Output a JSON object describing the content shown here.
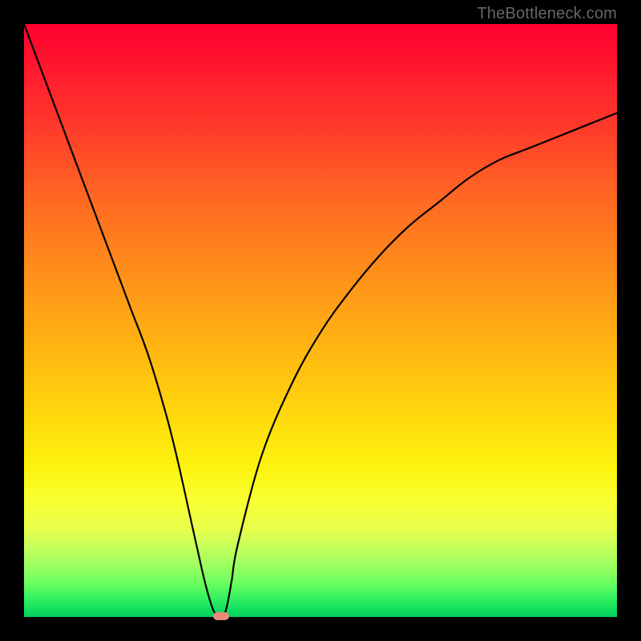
{
  "watermark": "TheBottleneck.com",
  "chart_data": {
    "type": "line",
    "title": "",
    "xlabel": "",
    "ylabel": "",
    "xlim": [
      0,
      100
    ],
    "ylim": [
      0,
      100
    ],
    "grid": false,
    "legend": false,
    "series": [
      {
        "name": "bottleneck-curve",
        "x": [
          0,
          3,
          6,
          9,
          12,
          15,
          18,
          21,
          24,
          26,
          28,
          30,
          31,
          32,
          33,
          34,
          35,
          36,
          40,
          45,
          50,
          55,
          60,
          65,
          70,
          75,
          80,
          85,
          90,
          95,
          100
        ],
        "values": [
          100,
          92,
          84,
          76,
          68,
          60,
          52,
          44,
          34,
          26,
          17,
          8,
          4,
          1,
          0,
          1,
          6,
          12,
          27,
          39,
          48,
          55,
          61,
          66,
          70,
          74,
          77,
          79,
          81,
          83,
          85
        ]
      }
    ],
    "marker": {
      "x": 33.2,
      "y": 0,
      "color": "#e88a7a"
    },
    "gradient_stops": [
      {
        "pct": 0,
        "color": "#ff0030"
      },
      {
        "pct": 30,
        "color": "#ff6a22"
      },
      {
        "pct": 66,
        "color": "#ffd80c"
      },
      {
        "pct": 85,
        "color": "#e8ff4a"
      },
      {
        "pct": 100,
        "color": "#00d060"
      }
    ]
  }
}
